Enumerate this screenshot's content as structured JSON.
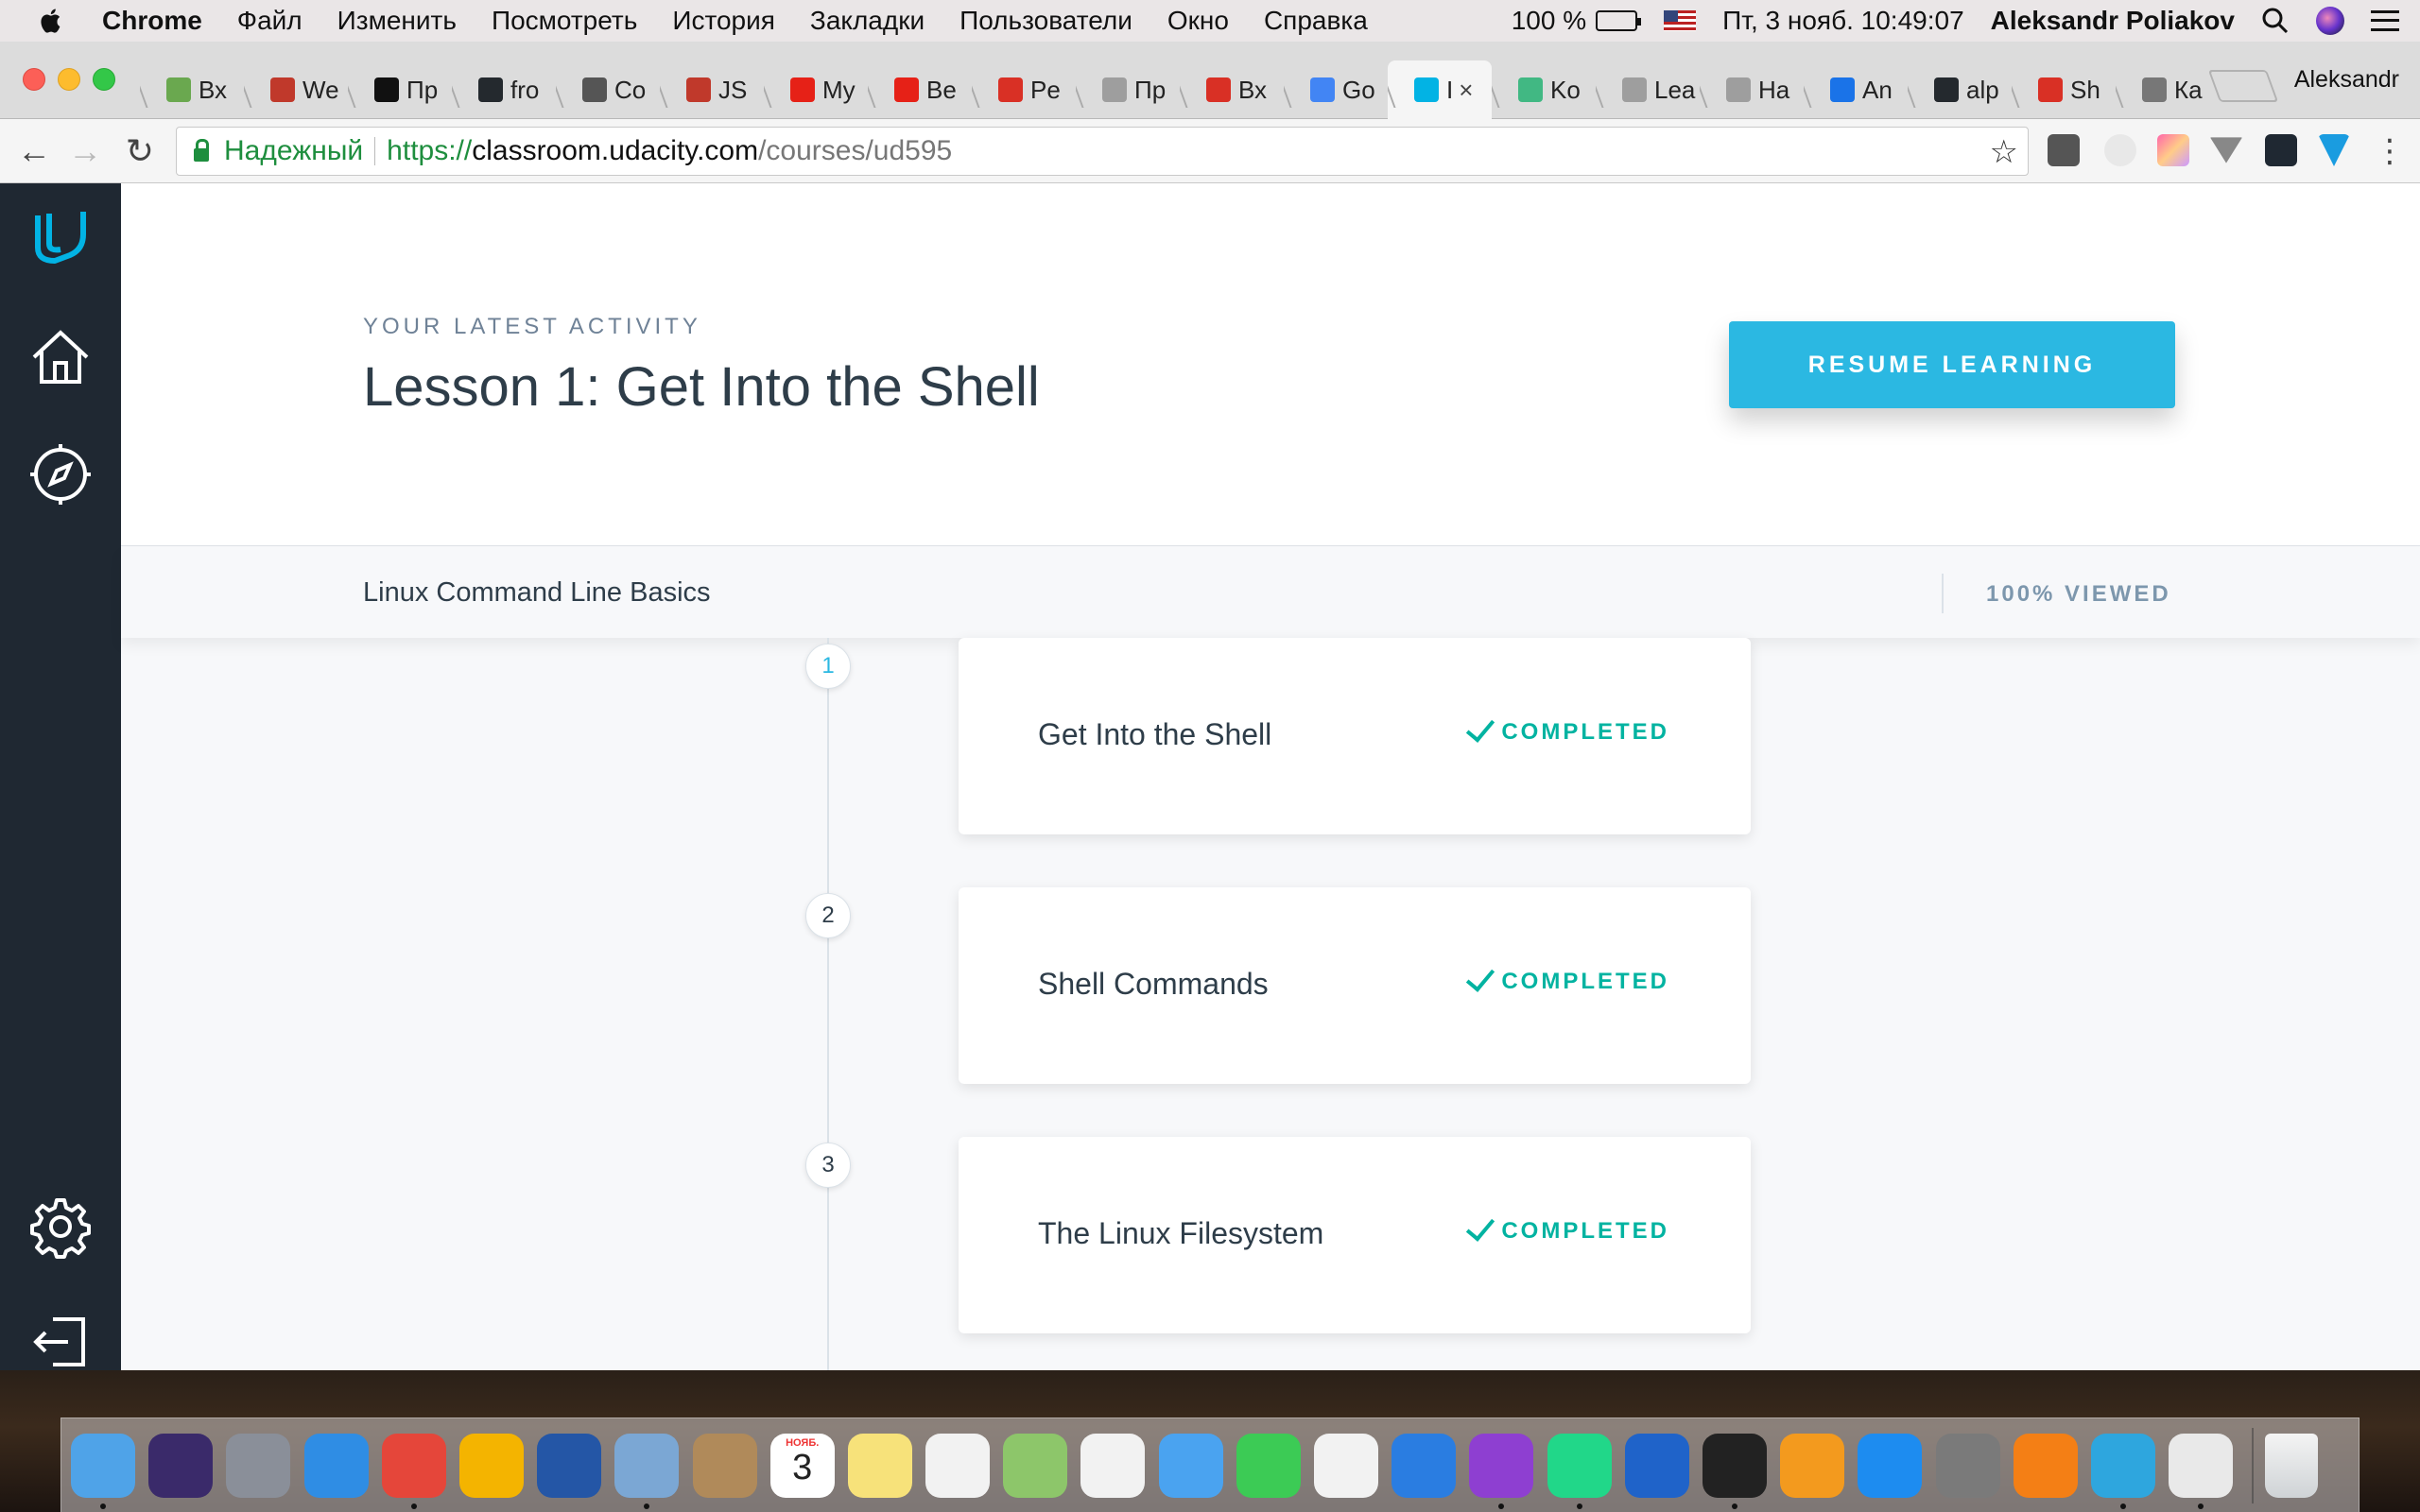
{
  "menubar": {
    "app_name": "Chrome",
    "menus": [
      "Файл",
      "Изменить",
      "Посмотреть",
      "История",
      "Закладки",
      "Пользователи",
      "Окно",
      "Справка"
    ],
    "battery": "100 %",
    "datetime": "Пт, 3 нояб.  10:49:07",
    "user": "Aleksandr Poliakov"
  },
  "tabs": [
    {
      "label": "Вх",
      "color": "#6aa84f"
    },
    {
      "label": "We",
      "color": "#c0392b"
    },
    {
      "label": "Пр",
      "color": "#111111"
    },
    {
      "label": "fro",
      "color": "#24292e"
    },
    {
      "label": "Co",
      "color": "#555555"
    },
    {
      "label": "JS",
      "color": "#c0392b"
    },
    {
      "label": "My",
      "color": "#e62117"
    },
    {
      "label": "Be",
      "color": "#e62117"
    },
    {
      "label": "Pe",
      "color": "#d93025"
    },
    {
      "label": "Пр",
      "color": "#9e9e9e"
    },
    {
      "label": "Вх",
      "color": "#d93025"
    },
    {
      "label": "Go",
      "color": "#4285f4"
    },
    {
      "label": "I",
      "color": "#02b3e4",
      "active": true
    },
    {
      "label": "Ko",
      "color": "#41b883"
    },
    {
      "label": "Lea",
      "color": "#9e9e9e"
    },
    {
      "label": "На",
      "color": "#9e9e9e"
    },
    {
      "label": "An",
      "color": "#1a73e8"
    },
    {
      "label": "alp",
      "color": "#24292e"
    },
    {
      "label": "Sh",
      "color": "#d93025"
    },
    {
      "label": "Ка",
      "color": "#777777"
    }
  ],
  "profile_name": "Aleksandr",
  "toolbar": {
    "secure_label": "Надежный",
    "url_scheme": "https://",
    "url_host": "classroom.udacity.com",
    "url_path": "/courses/ud595"
  },
  "hero": {
    "latest_label": "YOUR LATEST ACTIVITY",
    "lesson_title": "Lesson 1: Get Into the Shell",
    "resume_label": "RESUME LEARNING"
  },
  "course": {
    "name": "Linux Command Line Basics",
    "viewed": "100% VIEWED",
    "viewed_fraction": 1.0
  },
  "lessons": [
    {
      "number": "1",
      "title": "Get Into the Shell",
      "status": "COMPLETED"
    },
    {
      "number": "2",
      "title": "Shell Commands",
      "status": "COMPLETED"
    },
    {
      "number": "3",
      "title": "The Linux Filesystem",
      "status": "COMPLETED"
    }
  ],
  "dock": {
    "calendar_month": "НОЯБ.",
    "calendar_day": "3",
    "apps": [
      {
        "name": "finder-icon",
        "color": "#4fa3e8",
        "running": true
      },
      {
        "name": "siri-icon",
        "color": "#3a2a6a",
        "running": false
      },
      {
        "name": "launchpad-icon",
        "color": "#8a8f99",
        "running": false
      },
      {
        "name": "safari-icon",
        "color": "#2f8de4",
        "running": false
      },
      {
        "name": "chrome-icon",
        "color": "#e5463a",
        "running": true
      },
      {
        "name": "chrome-canary-icon",
        "color": "#f4b400",
        "running": false
      },
      {
        "name": "firefox-icon",
        "color": "#2456a6",
        "running": false
      },
      {
        "name": "mail-icon",
        "color": "#7ba7d4",
        "running": true
      },
      {
        "name": "contacts-icon",
        "color": "#b08a5a",
        "running": false
      },
      {
        "name": "calendar-icon",
        "color": "#ffffff",
        "running": false
      },
      {
        "name": "notes-icon",
        "color": "#f7e27a",
        "running": false
      },
      {
        "name": "reminders-icon",
        "color": "#f2f2f2",
        "running": false
      },
      {
        "name": "maps-icon",
        "color": "#8dc66a",
        "running": false
      },
      {
        "name": "photos-icon",
        "color": "#f2f2f2",
        "running": false
      },
      {
        "name": "messages-icon",
        "color": "#4aa3f0",
        "running": false
      },
      {
        "name": "facetime-icon",
        "color": "#3ccb55",
        "running": false
      },
      {
        "name": "itunes-icon",
        "color": "#f2f2f2",
        "running": false
      },
      {
        "name": "xcode-icon",
        "color": "#2a7de1",
        "running": false
      },
      {
        "name": "phpstorm-icon",
        "color": "#8e3fd1",
        "running": true
      },
      {
        "name": "pycharm-icon",
        "color": "#21d789",
        "running": true
      },
      {
        "name": "sourcetree-icon",
        "color": "#1f63c9",
        "running": false
      },
      {
        "name": "terminal-icon",
        "color": "#222222",
        "running": true
      },
      {
        "name": "ibooks-icon",
        "color": "#f39a1e",
        "running": false
      },
      {
        "name": "app-store-icon",
        "color": "#1d8cf0",
        "running": false
      },
      {
        "name": "system-preferences-icon",
        "color": "#7a7a7a",
        "running": false
      },
      {
        "name": "vlc-icon",
        "color": "#f47f15",
        "running": false
      },
      {
        "name": "telegram-icon",
        "color": "#2ea6de",
        "running": true
      },
      {
        "name": "slack-icon",
        "color": "#e9e9e9",
        "running": true
      }
    ],
    "trash": "trash-icon"
  }
}
